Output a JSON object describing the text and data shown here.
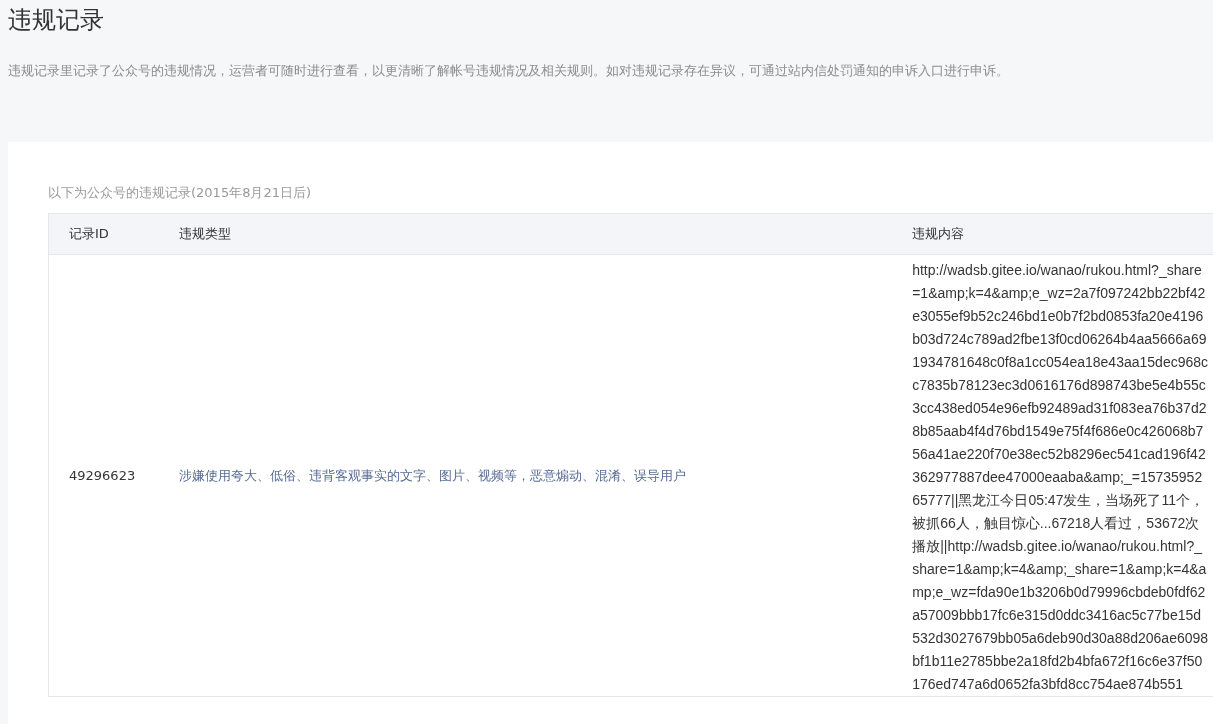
{
  "page": {
    "title": "违规记录",
    "description": "违规记录里记录了公众号的违规情况，运营者可随时进行查看，以更清晰了解帐号违规情况及相关规则。如对违规记录存在异议，可通过站内信处罚通知的申诉入口进行申诉。"
  },
  "records": {
    "caption": "以下为公众号的违规记录(2015年8月21日后)",
    "columns": [
      "记录ID",
      "违规类型",
      "违规内容"
    ],
    "rows": [
      {
        "id": "49296623",
        "type": "涉嫌使用夸大、低俗、违背客观事实的文字、图片、视频等，恶意煽动、混淆、误导用户",
        "content": "http://wadsb.gitee.io/wanao/rukou.html?_share=1&amp;k=4&amp;e_wz=2a7f097242bb22bf42e3055ef9b52c246bd1e0b7f2bd0853fa20e4196b03d724c789ad2fbe13f0cd06264b4aa5666a691934781648c0f8a1cc054ea18e43aa15dec968cc7835b78123ec3d0616176d898743be5e4b55c3cc438ed054e96efb92489ad31f083ea76b37d28b85aab4f4d76bd1549e75f4f686e0c426068b756a41ae220f70e38ec52b8296ec541cad196f42362977887dee47000eaaba&amp;_=1573595265777||黑龙江今日05:47发生，当场死了11个，被抓66人，触目惊心...67218人看过，53672次播放||http://wadsb.gitee.io/wanao/rukou.html?_share=1&amp;k=4&amp;_share=1&amp;k=4&amp;e_wz=fda90e1b3206b0d79996cbdeb0fdf62a57009bbb17fc6e315d0ddc3416ac5c77be15d532d3027679bb05a6deb90d30a88d206ae6098bf1b11e2785bbe2a18fd2b4bfa672f16c6e37f50176ed747a6d0652fa3bfd8cc754ae874b551"
      }
    ]
  }
}
